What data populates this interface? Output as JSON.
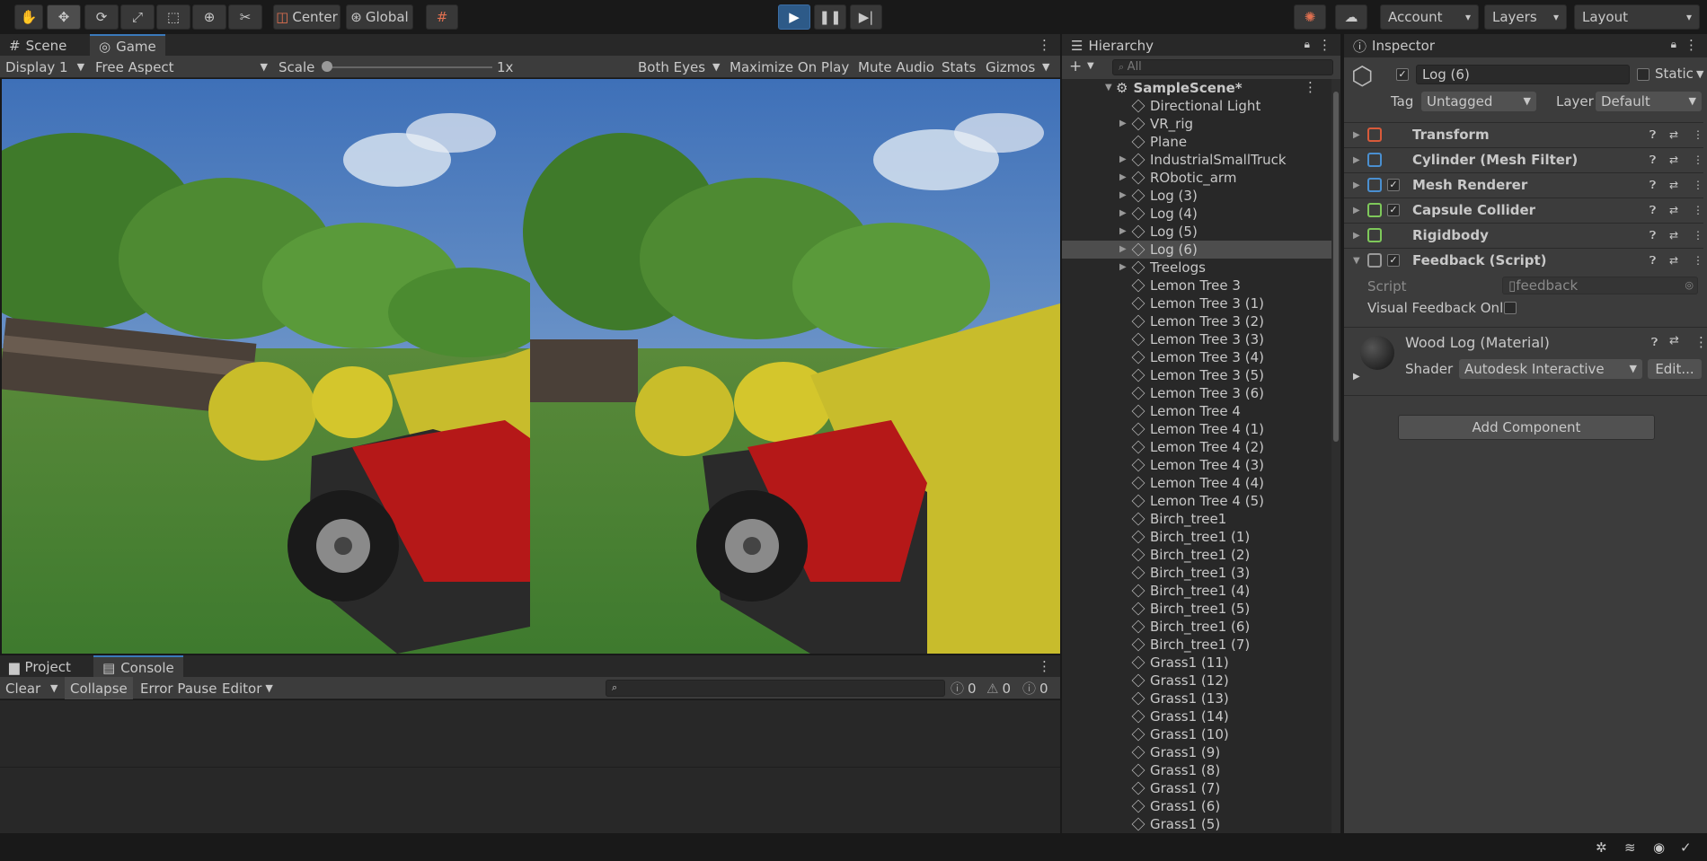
{
  "toolbar": {
    "center_label": "Center",
    "global_label": "Global",
    "account_label": "Account",
    "layers_label": "Layers",
    "layout_label": "Layout"
  },
  "game_panel": {
    "tabs": [
      "Scene",
      "Game"
    ],
    "display": "Display 1",
    "aspect": "Free Aspect",
    "scale_label": "Scale",
    "scale_value": "1x",
    "both_eyes": "Both Eyes",
    "maximize": "Maximize On Play",
    "mute": "Mute Audio",
    "stats": "Stats",
    "gizmos": "Gizmos"
  },
  "console_panel": {
    "tabs": [
      "Project",
      "Console"
    ],
    "clear": "Clear",
    "collapse": "Collapse",
    "error_pause": "Error Pause",
    "editor": "Editor",
    "count_info": "0",
    "count_warn": "0",
    "count_err": "0"
  },
  "hierarchy": {
    "title": "Hierarchy",
    "search_placeholder": "All",
    "scene": "SampleScene*",
    "items": [
      {
        "label": "Directional Light",
        "expandable": false
      },
      {
        "label": "VR_rig",
        "expandable": true
      },
      {
        "label": "Plane",
        "expandable": false
      },
      {
        "label": "IndustrialSmallTruck",
        "expandable": true
      },
      {
        "label": "RObotic_arm",
        "expandable": true
      },
      {
        "label": "Log (3)",
        "expandable": true
      },
      {
        "label": "Log (4)",
        "expandable": true
      },
      {
        "label": "Log (5)",
        "expandable": true
      },
      {
        "label": "Log (6)",
        "expandable": true,
        "selected": true
      },
      {
        "label": "Treelogs",
        "expandable": true
      },
      {
        "label": "Lemon Tree 3",
        "expandable": false
      },
      {
        "label": "Lemon Tree 3 (1)",
        "expandable": false
      },
      {
        "label": "Lemon Tree 3 (2)",
        "expandable": false
      },
      {
        "label": "Lemon Tree 3 (3)",
        "expandable": false
      },
      {
        "label": "Lemon Tree 3 (4)",
        "expandable": false
      },
      {
        "label": "Lemon Tree 3 (5)",
        "expandable": false
      },
      {
        "label": "Lemon Tree 3 (6)",
        "expandable": false
      },
      {
        "label": "Lemon Tree 4",
        "expandable": false
      },
      {
        "label": "Lemon Tree 4 (1)",
        "expandable": false
      },
      {
        "label": "Lemon Tree 4 (2)",
        "expandable": false
      },
      {
        "label": "Lemon Tree 4 (3)",
        "expandable": false
      },
      {
        "label": "Lemon Tree 4 (4)",
        "expandable": false
      },
      {
        "label": "Lemon Tree 4 (5)",
        "expandable": false
      },
      {
        "label": "Birch_tree1",
        "expandable": false
      },
      {
        "label": "Birch_tree1 (1)",
        "expandable": false
      },
      {
        "label": "Birch_tree1 (2)",
        "expandable": false
      },
      {
        "label": "Birch_tree1 (3)",
        "expandable": false
      },
      {
        "label": "Birch_tree1 (4)",
        "expandable": false
      },
      {
        "label": "Birch_tree1 (5)",
        "expandable": false
      },
      {
        "label": "Birch_tree1 (6)",
        "expandable": false
      },
      {
        "label": "Birch_tree1 (7)",
        "expandable": false
      },
      {
        "label": "Grass1 (11)",
        "expandable": false
      },
      {
        "label": "Grass1 (12)",
        "expandable": false
      },
      {
        "label": "Grass1 (13)",
        "expandable": false
      },
      {
        "label": "Grass1 (14)",
        "expandable": false
      },
      {
        "label": "Grass1 (10)",
        "expandable": false
      },
      {
        "label": "Grass1 (9)",
        "expandable": false
      },
      {
        "label": "Grass1 (8)",
        "expandable": false
      },
      {
        "label": "Grass1 (7)",
        "expandable": false
      },
      {
        "label": "Grass1 (6)",
        "expandable": false
      },
      {
        "label": "Grass1 (5)",
        "expandable": false
      }
    ]
  },
  "inspector": {
    "title": "Inspector",
    "object_name": "Log (6)",
    "static_label": "Static",
    "tag_label": "Tag",
    "tag_value": "Untagged",
    "layer_label": "Layer",
    "layer_value": "Default",
    "components": [
      {
        "name": "Transform",
        "has_checkbox": false,
        "icon": "transform-icon",
        "color": "#d85a3a"
      },
      {
        "name": "Cylinder (Mesh Filter)",
        "has_checkbox": false,
        "icon": "mesh-filter-icon",
        "color": "#4a8fd0"
      },
      {
        "name": "Mesh Renderer",
        "has_checkbox": true,
        "icon": "mesh-renderer-icon",
        "color": "#4a8fd0"
      },
      {
        "name": "Capsule Collider",
        "has_checkbox": true,
        "icon": "capsule-collider-icon",
        "color": "#7ec85a"
      },
      {
        "name": "Rigidbody",
        "has_checkbox": false,
        "icon": "rigidbody-icon",
        "color": "#7ec85a"
      },
      {
        "name": "Feedback (Script)",
        "has_checkbox": true,
        "icon": "script-icon",
        "color": "#9a9a9a"
      }
    ],
    "script_label": "Script",
    "script_value": "feedback",
    "visual_feedback_label": "Visual Feedback Onl",
    "material_name": "Wood Log (Material)",
    "shader_label": "Shader",
    "shader_value": "Autodesk Interactive",
    "edit_label": "Edit...",
    "add_component": "Add Component"
  }
}
